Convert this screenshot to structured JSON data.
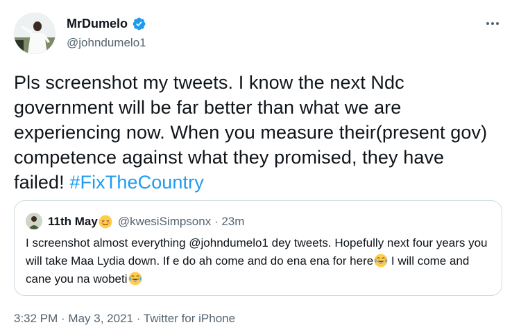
{
  "tweet": {
    "author_name": "MrDumelo",
    "author_handle": "@johndumelo1",
    "text": "Pls screenshot my tweets. I know the next Ndc government will be far better than what we are experiencing now. When you measure their(present gov) competence against what they promised, they have failed! ",
    "hashtag": "#FixTheCountry",
    "icons": {
      "verified": "verified-badge-icon",
      "more": "more-options-icon"
    },
    "colors": {
      "link": "#1d9bf0",
      "verified": "#1d9bf0",
      "muted": "#536471",
      "border": "#cfd9de"
    }
  },
  "quote": {
    "author_name": "11th May",
    "name_emoji": "relieved-face-emoji",
    "author_handle": "@kwesiSimpsonx",
    "separator": " · ",
    "time_ago": "23m",
    "text_part1": "I screenshot almost everything @johndumelo1 dey tweets. Hopefully next four years you will take Maa Lydia down. If e do ah come and do ena ena for here",
    "text_part2": " I will come and cane you na wobeti",
    "inline_emoji": "face-with-tears-of-joy-emoji"
  },
  "footer": {
    "time": "3:32 PM",
    "separator": " · ",
    "date": "May 3, 2021",
    "source": "Twitter for iPhone"
  }
}
